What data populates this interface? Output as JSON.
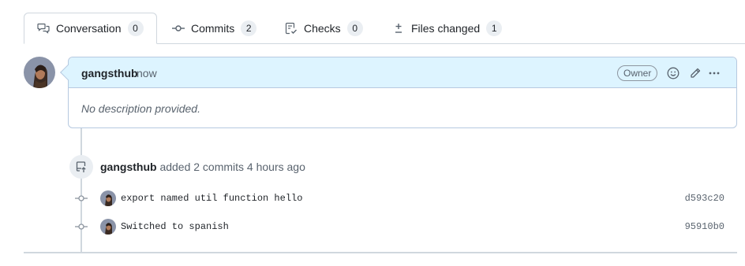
{
  "tabs": [
    {
      "label": "Conversation",
      "count": "0",
      "icon": "comment-discussion-icon",
      "selected": true
    },
    {
      "label": "Commits",
      "count": "2",
      "icon": "git-commit-icon",
      "selected": false
    },
    {
      "label": "Checks",
      "count": "0",
      "icon": "checklist-icon",
      "selected": false
    },
    {
      "label": "Files changed",
      "count": "1",
      "icon": "file-diff-icon",
      "selected": false
    }
  ],
  "comment": {
    "author": "gangsthub",
    "timestamp": "now",
    "badge": "Owner",
    "body": "No description provided.",
    "actions": [
      "smiley-icon",
      "pencil-icon",
      "kebab-horizontal-icon"
    ]
  },
  "event": {
    "actor": "gangsthub",
    "text": "added 2 commits 4 hours ago",
    "icon": "repo-push-icon"
  },
  "commits": [
    {
      "message": "export named util function hello",
      "sha": "d593c20"
    },
    {
      "message": "Switched to spanish",
      "sha": "95910b0"
    }
  ],
  "colors": {
    "header_bg": "#ddf4ff",
    "border": "#d0d7de",
    "muted": "#59636e",
    "text": "#1f2328"
  }
}
